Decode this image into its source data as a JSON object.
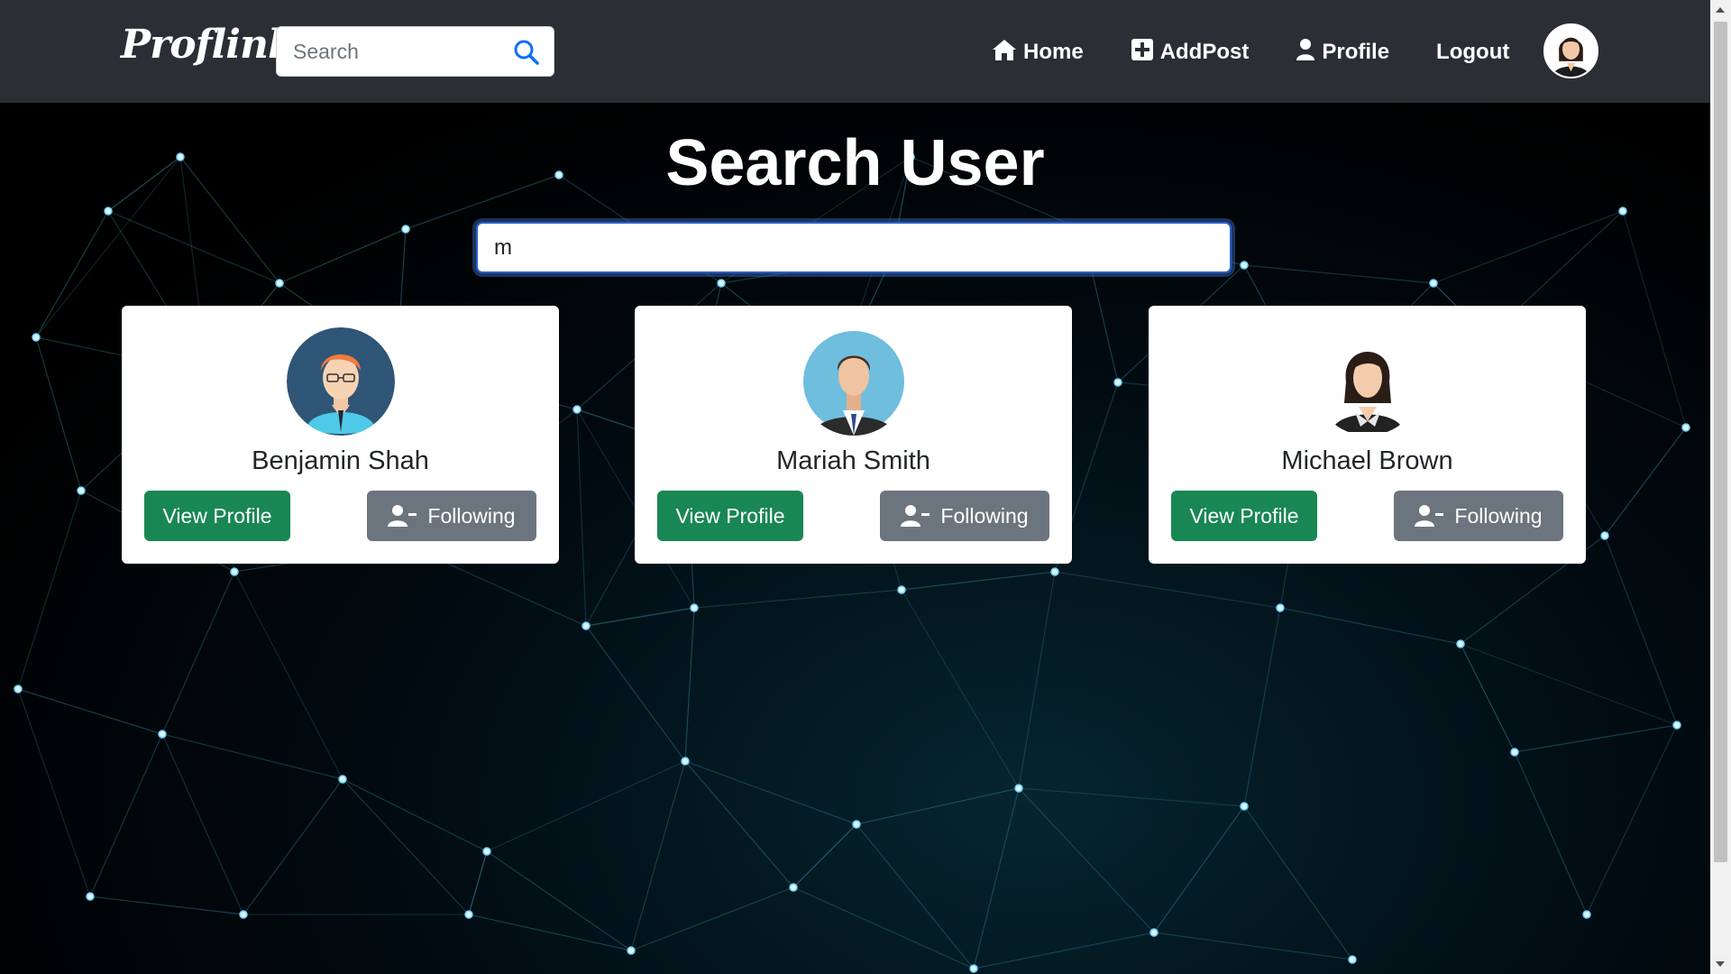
{
  "navbar": {
    "brand": "Proflink",
    "search_placeholder": "Search",
    "links": [
      {
        "label": "Home",
        "icon": "home-icon"
      },
      {
        "label": "AddPost",
        "icon": "plus-square-icon"
      },
      {
        "label": "Profile",
        "icon": "user-icon"
      },
      {
        "label": "Logout",
        "icon": ""
      }
    ],
    "avatar": "female-user-avatar"
  },
  "main": {
    "title": "Search User",
    "search_value": "m"
  },
  "results": [
    {
      "name": "Benjamin Shah",
      "view_label": "View Profile",
      "follow_label": "Following",
      "avatar": "male-glasses-avatar"
    },
    {
      "name": "Mariah Smith",
      "view_label": "View Profile",
      "follow_label": "Following",
      "avatar": "male-suit-avatar"
    },
    {
      "name": "Michael Brown",
      "view_label": "View Profile",
      "follow_label": "Following",
      "avatar": "female-avatar"
    }
  ],
  "colors": {
    "navbar": "#2b2e35",
    "view_button": "#198754",
    "follow_button": "#6c757d",
    "focus_ring": "#2a5ec8"
  }
}
